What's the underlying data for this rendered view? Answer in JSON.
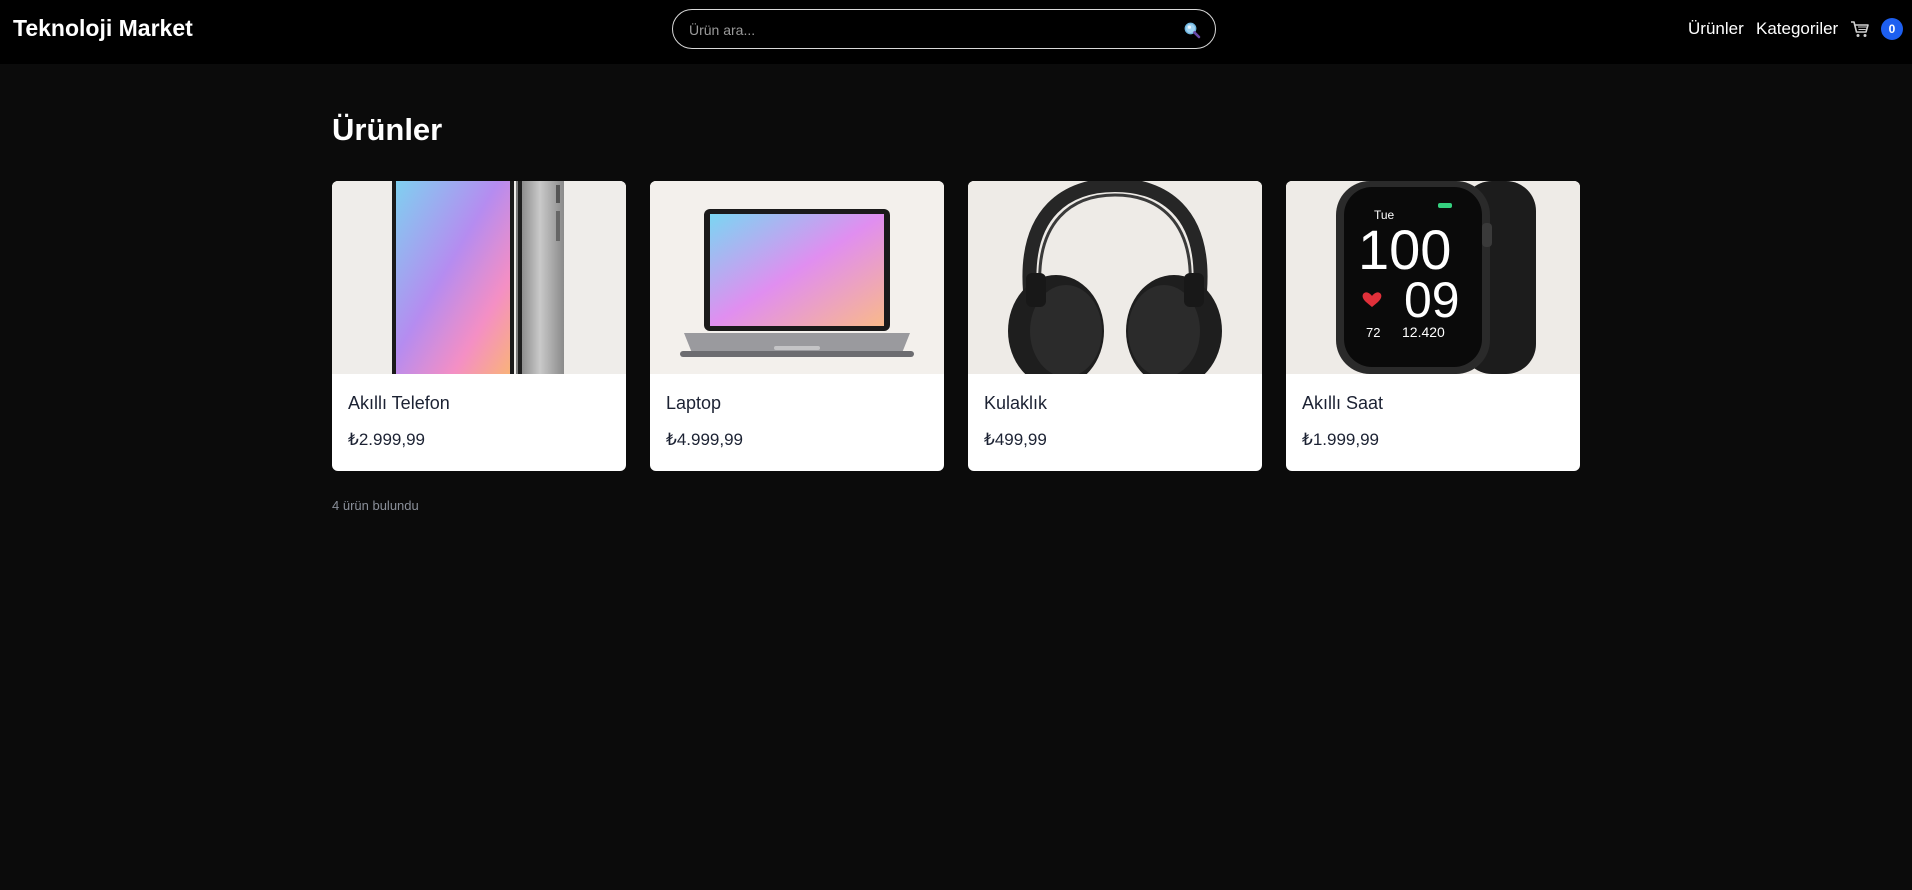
{
  "header": {
    "brand": "Teknoloji Market",
    "search_placeholder": "Ürün ara...",
    "search_icon": "search-icon",
    "nav": {
      "products": "Ürünler",
      "categories": "Kategoriler"
    },
    "cart": {
      "icon": "cart-icon",
      "count": "0",
      "badge_color": "#1d5ff0"
    }
  },
  "main": {
    "title": "Ürünler",
    "products": [
      {
        "name": "Akıllı Telefon",
        "price": "₺2.999,99",
        "image": "smartphone"
      },
      {
        "name": "Laptop",
        "price": "₺4.999,99",
        "image": "laptop"
      },
      {
        "name": "Kulaklık",
        "price": "₺499,99",
        "image": "headphones"
      },
      {
        "name": "Akıllı Saat",
        "price": "₺1.999,99",
        "image": "smartwatch"
      }
    ],
    "result_count": "4 ürün bulundu",
    "watch_screen": {
      "day": "Tue",
      "hour": "100",
      "minute": "09",
      "heart": "72",
      "steps": "12.420"
    }
  },
  "colors": {
    "background": "#0b0b0b",
    "header": "#000000",
    "card": "#ffffff",
    "text_dark": "#1c2233"
  }
}
